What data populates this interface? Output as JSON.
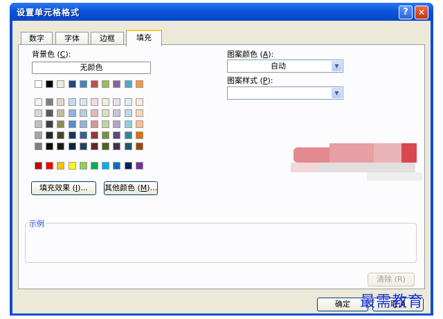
{
  "window": {
    "title": "设置单元格格式",
    "help_glyph": "?",
    "close_glyph": "✕"
  },
  "tabs": [
    "数字",
    "字体",
    "边框",
    "填充"
  ],
  "active_tab": "填充",
  "background_color": {
    "label_text": "背景色 (",
    "label_key": "C",
    "label_end": "):",
    "no_color_button": "无颜色"
  },
  "palette": {
    "top_row": [
      "#ffffff",
      "#000000",
      "#eeece1",
      "#1f497d",
      "#4f81bd",
      "#c0504d",
      "#9bbb59",
      "#8064a2",
      "#4bacc6",
      "#f79646"
    ],
    "theme_rows": [
      [
        "#f2f2f2",
        "#7f7f7f",
        "#ddd9c3",
        "#c6d9f0",
        "#dbe5f1",
        "#f2dcdb",
        "#ebf1dd",
        "#e5e0ec",
        "#dbeef3",
        "#fdeada"
      ],
      [
        "#d8d8d8",
        "#595959",
        "#c4bd97",
        "#8db3e2",
        "#b8cce4",
        "#e5b9b7",
        "#d7e3bc",
        "#ccc1d9",
        "#b7dde8",
        "#fbd5b5"
      ],
      [
        "#bfbfbf",
        "#3f3f3f",
        "#938953",
        "#548dd4",
        "#95b3d7",
        "#d99694",
        "#c3d69b",
        "#b2a2c7",
        "#92cddc",
        "#fac08f"
      ],
      [
        "#a5a5a5",
        "#262626",
        "#494429",
        "#17365d",
        "#366092",
        "#953734",
        "#76923c",
        "#5f497a",
        "#31859b",
        "#e36c09"
      ],
      [
        "#7f7f7f",
        "#0c0c0c",
        "#1d1b10",
        "#0f243e",
        "#244061",
        "#632423",
        "#4f6128",
        "#3f3151",
        "#205867",
        "#974806"
      ]
    ],
    "standard_row": [
      "#c00000",
      "#ff0000",
      "#ffc000",
      "#ffff00",
      "#92d050",
      "#00b050",
      "#00b0f0",
      "#0070c0",
      "#002060",
      "#7030a0"
    ]
  },
  "fill_effects_button": {
    "text": "填充效果 (",
    "key": "I",
    "end": ")..."
  },
  "more_colors_button": {
    "text": "其他颜色 (",
    "key": "M",
    "end": ")..."
  },
  "pattern_color": {
    "label_text": "图案颜色 (",
    "label_key": "A",
    "label_end": "):",
    "value": "自动"
  },
  "pattern_style": {
    "label_text": "图案样式 (",
    "label_key": "P",
    "label_end": "):",
    "value": ""
  },
  "sample": {
    "label": "示例"
  },
  "clear_button": "清除 (R)",
  "ok_button": "确定",
  "cancel_button": "取消",
  "watermark": "最需教育"
}
